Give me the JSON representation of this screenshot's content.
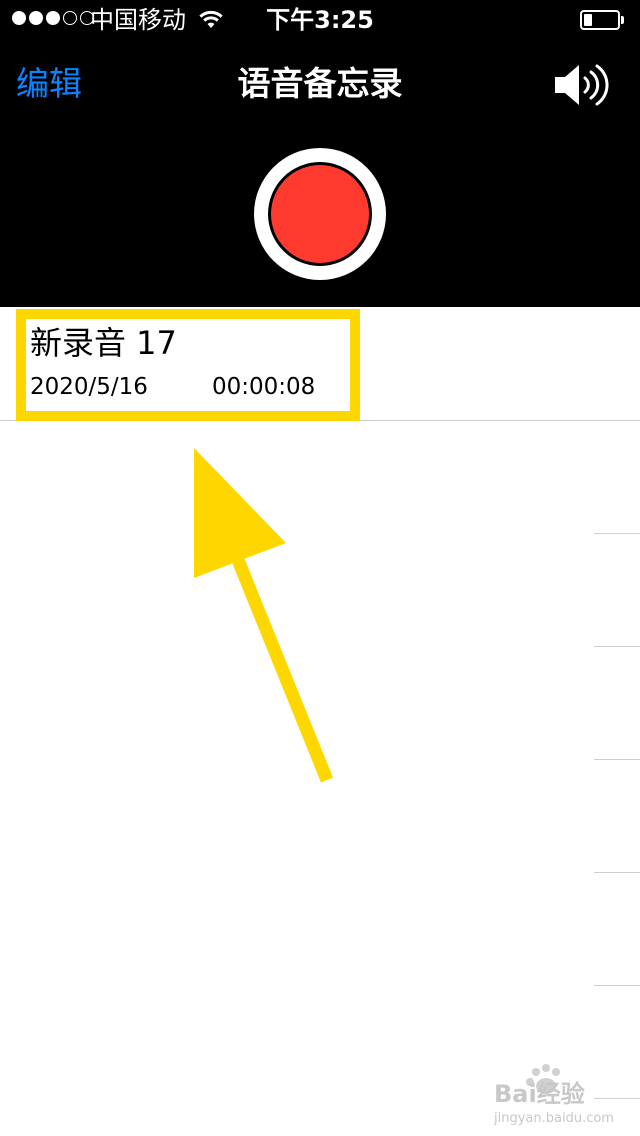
{
  "status_bar": {
    "carrier": "中国移动",
    "time": "下午3:25",
    "signal_strength": 3,
    "signal_max": 5,
    "battery_level": 0.25
  },
  "nav": {
    "edit_label": "编辑",
    "title": "语音备忘录"
  },
  "recordings": [
    {
      "title": "新录音 17",
      "date": "2020/5/16",
      "duration": "00:00:08"
    }
  ],
  "colors": {
    "accent": "#0a84ff",
    "record": "#ff3b30",
    "highlight": "#ffd700"
  },
  "icons": {
    "speaker": "speaker-volume-icon",
    "record": "record-icon",
    "wifi": "wifi-icon",
    "battery": "battery-icon",
    "annotation_arrow": "arrow-icon",
    "watermark": "baidu-logo"
  },
  "watermark": {
    "logo_text": "Bai经验",
    "url": "jingyan.baidu.com"
  }
}
